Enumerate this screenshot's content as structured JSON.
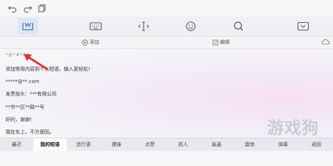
{
  "topbar": {
    "icons": [
      "undo-icon",
      "redo-icon",
      "copy-icon"
    ]
  },
  "toolbar": {
    "icons": [
      "phrase-box-icon",
      "keyboard-icon",
      "cursor-icon",
      "emoji-icon",
      "search-icon",
      "collapse-icon"
    ]
  },
  "actions": {
    "add_label": "添加",
    "edit_label": "编辑"
  },
  "phrases": [
    "*@*#*&*",
    "添加常用内容到个人短语，输入更轻松!",
    "*****@**.com",
    "发票抬头：***有限公司",
    "**市**区**路**号",
    "好的，谢谢!",
    "我在车上，不方便回。"
  ],
  "tabs": [
    "最近",
    "我的短语",
    "流行语",
    "撩妹",
    "点赞",
    "损人",
    "装逼",
    "震惊",
    "弹幕",
    "返回"
  ],
  "watermark": "游戏狗",
  "colors": {
    "accent": "#3d6fb4",
    "annotation_arrow": "#e0352b",
    "selected_tab": "#ffffff"
  }
}
